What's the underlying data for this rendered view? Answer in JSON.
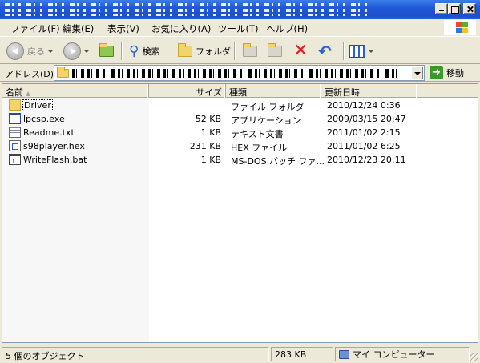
{
  "menu": [
    "ファイル(F)",
    "編集(E)",
    "表示(V)",
    "お気に入り(A)",
    "ツール(T)",
    "ヘルプ(H)"
  ],
  "toolbar": {
    "back_label": "戻る",
    "search_label": "検索",
    "folders_label": "フォルダ"
  },
  "address": {
    "label": "アドレス(D)",
    "go_label": "移動"
  },
  "columns": {
    "name": "名前",
    "size": "サイズ",
    "type": "種類",
    "date": "更新日時"
  },
  "files": [
    {
      "name": "Driver",
      "size": "",
      "type": "ファイル フォルダ",
      "date": "2010/12/24 0:36",
      "icon": "folder-icon"
    },
    {
      "name": "lpcsp.exe",
      "size": "52 KB",
      "type": "アプリケーション",
      "date": "2009/03/15 20:47",
      "icon": "exe-icon"
    },
    {
      "name": "Readme.txt",
      "size": "1 KB",
      "type": "テキスト文書",
      "date": "2011/01/02 2:15",
      "icon": "text-file-icon"
    },
    {
      "name": "s98player.hex",
      "size": "231 KB",
      "type": "HEX ファイル",
      "date": "2011/01/02 6:25",
      "icon": "hex-file-icon"
    },
    {
      "name": "WriteFlash.bat",
      "size": "1 KB",
      "type": "MS-DOS バッチ ファ...",
      "date": "2010/12/23 20:11",
      "icon": "batch-file-icon"
    }
  ],
  "status": {
    "count": "5 個のオブジェクト",
    "total_size": "283 KB",
    "zone": "マイ コンピューター"
  },
  "colors": {
    "titlebar": "#2059d6",
    "window_bg": "#ece9d8",
    "list_bg": "#ffffff"
  }
}
